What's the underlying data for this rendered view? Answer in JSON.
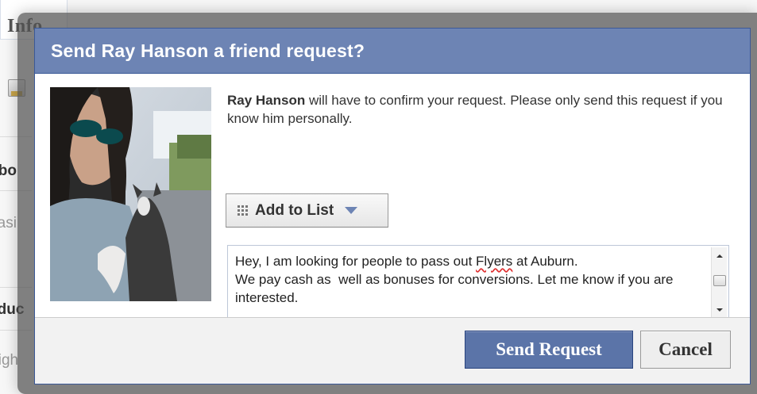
{
  "background": {
    "tab_label": "Info",
    "sections": [
      "Abo",
      "Basi",
      "Educ",
      "Righ"
    ]
  },
  "dialog": {
    "title": "Send Ray Hanson a friend request?",
    "name": "Ray Hanson",
    "confirm_text": " will have to confirm your request. Please only send this request if you know him personally.",
    "add_to_list_label": "Add to List",
    "message_parts": {
      "before": "Hey, I am looking for people to pass out ",
      "misspelled": "Flyers",
      "after": " at Auburn.\nWe pay cash as  well as bonuses for conversions. Let me know if you are interested."
    },
    "send_button": "Send Request",
    "cancel_button": "Cancel"
  },
  "colors": {
    "header": "#6d84b4",
    "primary_button": "#5b74a8",
    "border": "#3b5998"
  },
  "icons": {
    "list": "grid-icon",
    "dropdown": "chevron-down-icon"
  }
}
